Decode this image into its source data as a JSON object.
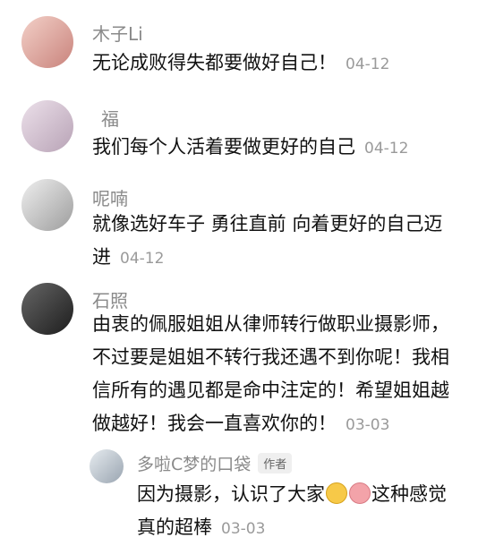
{
  "comments": [
    {
      "user": "木子Li",
      "lines": [
        "无论成败得失都要做好自己！"
      ],
      "time": "04-12"
    },
    {
      "user": "福",
      "lines": [
        "我们每个人活着要做更好的自己"
      ],
      "time": "04-12"
    },
    {
      "user": "呢喃",
      "lines": [
        "就像选好车子 勇往直前 向着更好的自己迈",
        "进"
      ],
      "time": "04-12"
    },
    {
      "user": "石照",
      "lines": [
        "由衷的佩服姐姐从律师转行做职业摄影师，",
        "不过要是姐姐不转行我还遇不到你呢！我相",
        "信所有的遇见都是命中注定的！希望姐姐越",
        "做越好！我会一直喜欢你的！"
      ],
      "time": "03-03"
    }
  ],
  "reply": {
    "user": "多啦C梦的口袋",
    "tag": "作者",
    "line1": "因为摄影，认识了大家",
    "line1_after": "这种感觉",
    "line2": "真的超棒",
    "time": "03-03",
    "emoji_icons": [
      "smiling-duck-emoji-icon",
      "laughing-pig-emoji-icon"
    ]
  },
  "avatar_colors": [
    "#e9b9b4",
    "#d9c6d6",
    "#d7d7d7",
    "#3a3a3a",
    "#cfd6de"
  ]
}
